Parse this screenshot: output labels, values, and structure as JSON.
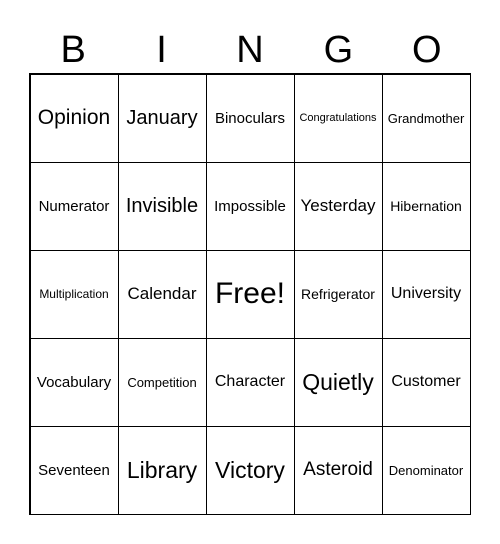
{
  "header": [
    "B",
    "I",
    "N",
    "G",
    "O"
  ],
  "cells": [
    [
      "Opinion",
      "January",
      "Binoculars",
      "Congratulations",
      "Grandmother"
    ],
    [
      "Numerator",
      "Invisible",
      "Impossible",
      "Yesterday",
      "Hibernation"
    ],
    [
      "Multiplication",
      "Calendar",
      "Free!",
      "Refrigerator",
      "University"
    ],
    [
      "Vocabulary",
      "Competition",
      "Character",
      "Quietly",
      "Customer"
    ],
    [
      "Seventeen",
      "Library",
      "Victory",
      "Asteroid",
      "Denominator"
    ]
  ]
}
